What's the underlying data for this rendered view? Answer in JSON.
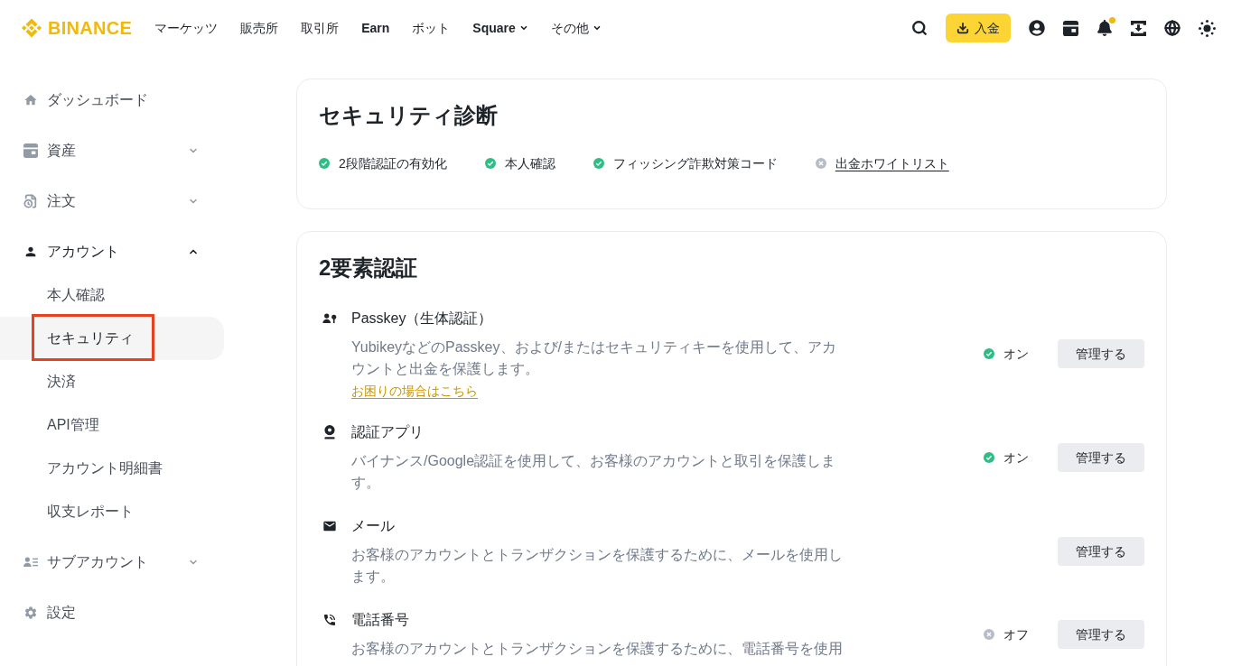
{
  "header": {
    "logo": "BINANCE",
    "nav": [
      {
        "label": "マーケッツ",
        "bold": false,
        "dropdown": false
      },
      {
        "label": "販売所",
        "bold": false,
        "dropdown": false
      },
      {
        "label": "取引所",
        "bold": false,
        "dropdown": false
      },
      {
        "label": "Earn",
        "bold": true,
        "dropdown": false
      },
      {
        "label": "ボット",
        "bold": false,
        "dropdown": false
      },
      {
        "label": "Square",
        "bold": true,
        "dropdown": true
      },
      {
        "label": "その他",
        "bold": false,
        "dropdown": true
      }
    ],
    "deposit_button": "入金",
    "notification_unread": true
  },
  "sidebar": {
    "items": [
      {
        "label": "ダッシュボード"
      },
      {
        "label": "資産",
        "expanded": false
      },
      {
        "label": "注文",
        "expanded": false
      },
      {
        "label": "アカウント",
        "expanded": true,
        "children": [
          {
            "label": "本人確認",
            "selected": false,
            "highlighted": false
          },
          {
            "label": "セキュリティ",
            "selected": true,
            "highlighted": true
          },
          {
            "label": "決済",
            "selected": false,
            "highlighted": false
          },
          {
            "label": "API管理",
            "selected": false,
            "highlighted": false
          },
          {
            "label": "アカウント明細書",
            "selected": false,
            "highlighted": false
          },
          {
            "label": "収支レポート",
            "selected": false,
            "highlighted": false
          }
        ]
      },
      {
        "label": "サブアカウント",
        "expanded": false
      },
      {
        "label": "設定"
      }
    ]
  },
  "security_checkup": {
    "title": "セキュリティ診断",
    "items": [
      {
        "label": "2段階認証の有効化",
        "done": true
      },
      {
        "label": "本人確認",
        "done": true
      },
      {
        "label": "フィッシング詐欺対策コード",
        "done": true
      },
      {
        "label": "出金ホワイトリスト",
        "done": false
      }
    ]
  },
  "two_factor": {
    "title": "2要素認証",
    "methods": [
      {
        "title": "Passkey（生体認証）",
        "description": "YubikeyなどのPasskey、および/またはセキュリティキーを使用して、アカウントと出金を保護します。",
        "help_link": "お困りの場合はこちら",
        "enabled": true,
        "status": "オン",
        "button": "管理する"
      },
      {
        "title": "認証アプリ",
        "description": "バイナンス/Google認証を使用して、お客様のアカウントと取引を保護します。",
        "enabled": true,
        "status": "オン",
        "button": "管理する"
      },
      {
        "title": "メール",
        "description": "お客様のアカウントとトランザクションを保護するために、メールを使用します。",
        "button": "管理する"
      },
      {
        "title": "電話番号",
        "description": "お客様のアカウントとトランザクションを保護するために、電話番号を使用",
        "enabled": false,
        "status": "オフ",
        "button": "管理する"
      }
    ]
  }
}
